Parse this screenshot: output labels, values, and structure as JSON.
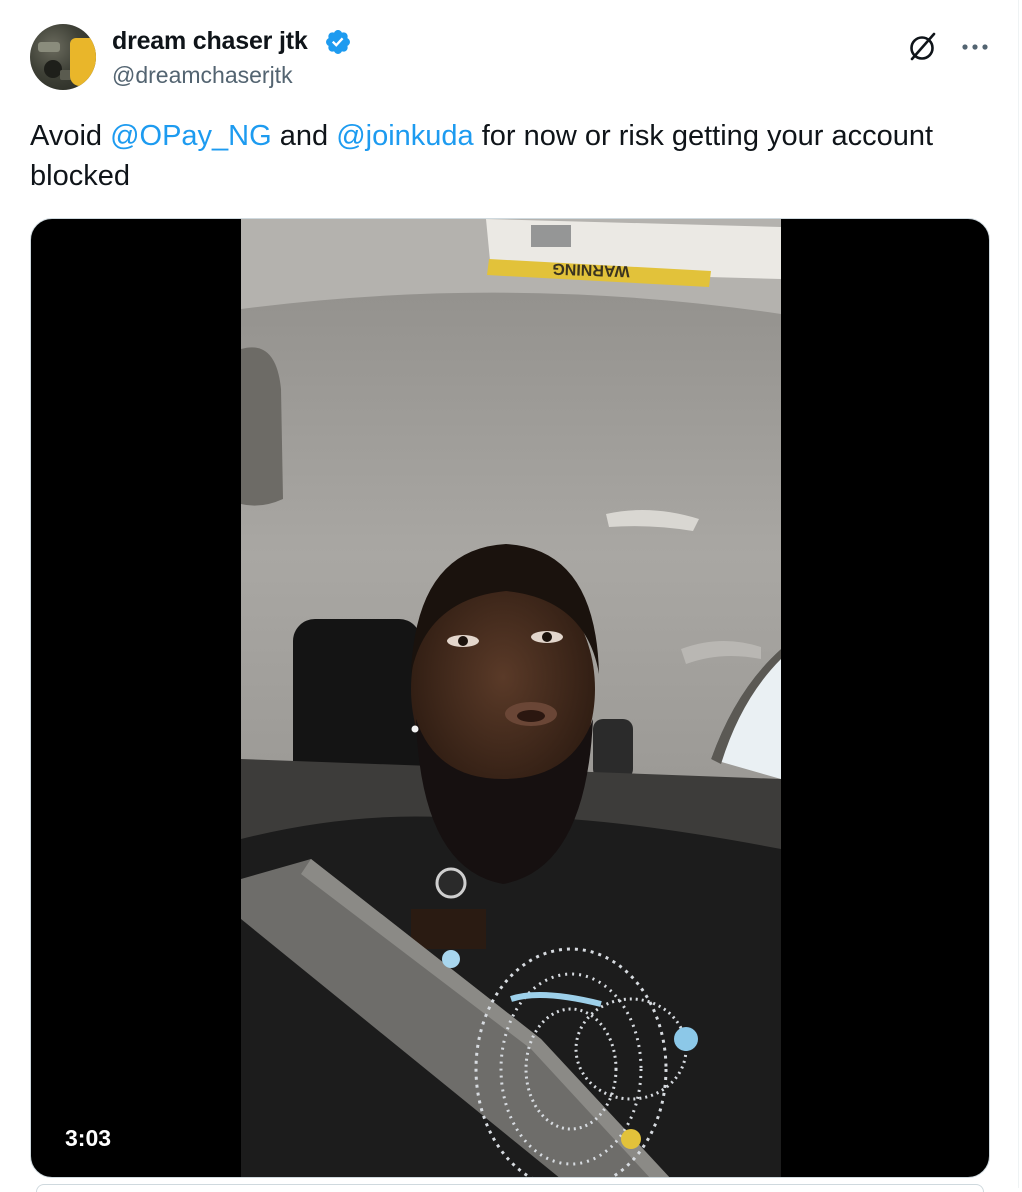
{
  "author": {
    "display_name": "dream chaser jtk",
    "handle": "@dreamchaserjtk",
    "verified": true,
    "avatar_icon": "avatar-photo",
    "verified_icon": "verified-check-icon"
  },
  "actions": {
    "grok_icon": "grok-icon",
    "more_icon": "more-options-icon"
  },
  "tweet": {
    "text_prefix": "Avoid ",
    "mention_1": "@OPay_NG",
    "text_middle": " and ",
    "mention_2": "@joinkuda",
    "text_suffix": " for now or risk getting your account blocked"
  },
  "media": {
    "type": "video",
    "duration": "3:03",
    "sun_visor_label": "WARNING"
  },
  "colors": {
    "link": "#1d9bf0",
    "verified": "#1d9bf0",
    "text": "#0f1419",
    "secondary_text": "#536471",
    "border": "#cfd9de"
  }
}
